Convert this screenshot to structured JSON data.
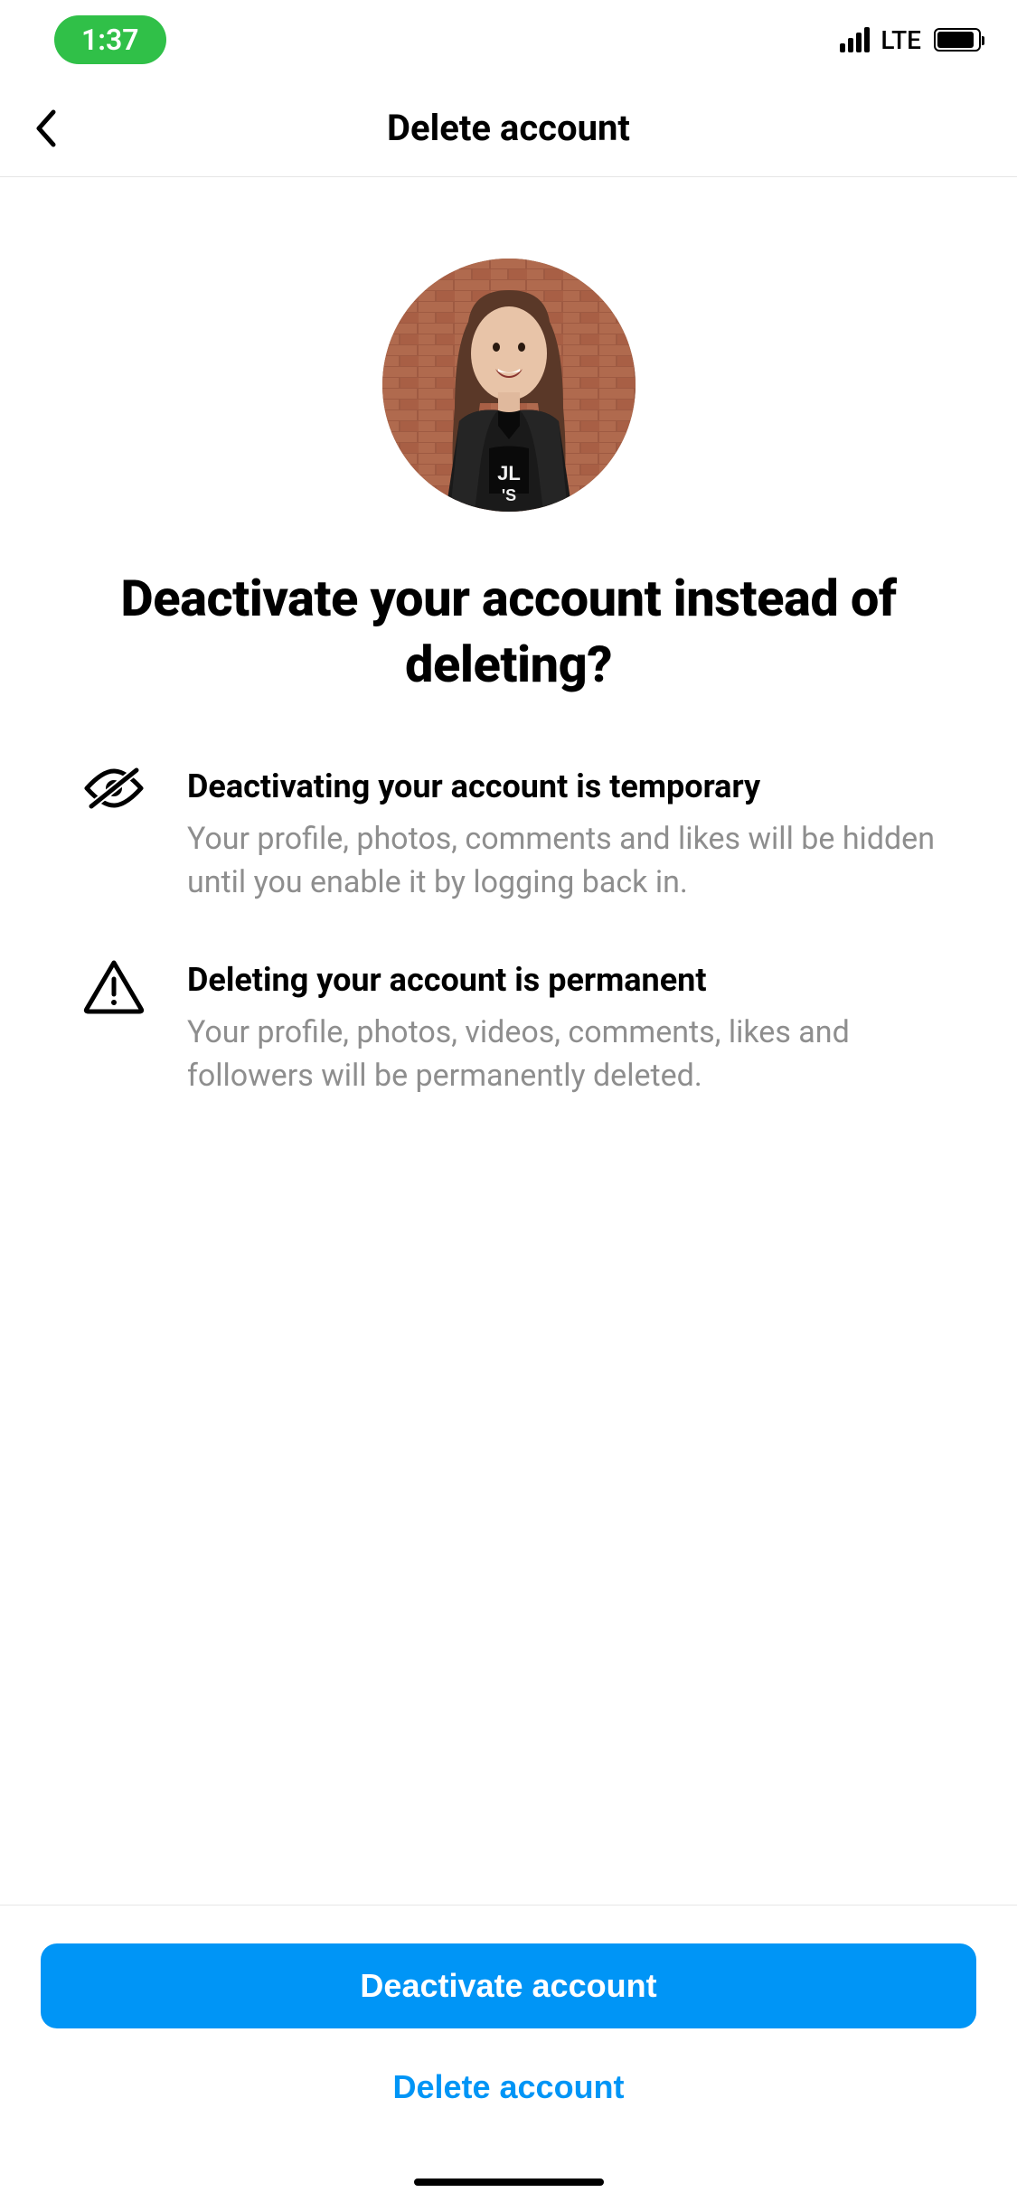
{
  "statusBar": {
    "time": "1:37",
    "network": "LTE"
  },
  "header": {
    "title": "Delete account"
  },
  "content": {
    "headline": "Deactivate your account instead of deleting?",
    "sections": [
      {
        "title": "Deactivating your account is temporary",
        "description": "Your profile, photos, comments and likes will be hidden until you enable it by logging back in."
      },
      {
        "title": "Deleting your account is permanent",
        "description": "Your profile, photos, videos, comments, likes and followers will be permanently deleted."
      }
    ]
  },
  "actions": {
    "primary": "Deactivate account",
    "secondary": "Delete account"
  }
}
